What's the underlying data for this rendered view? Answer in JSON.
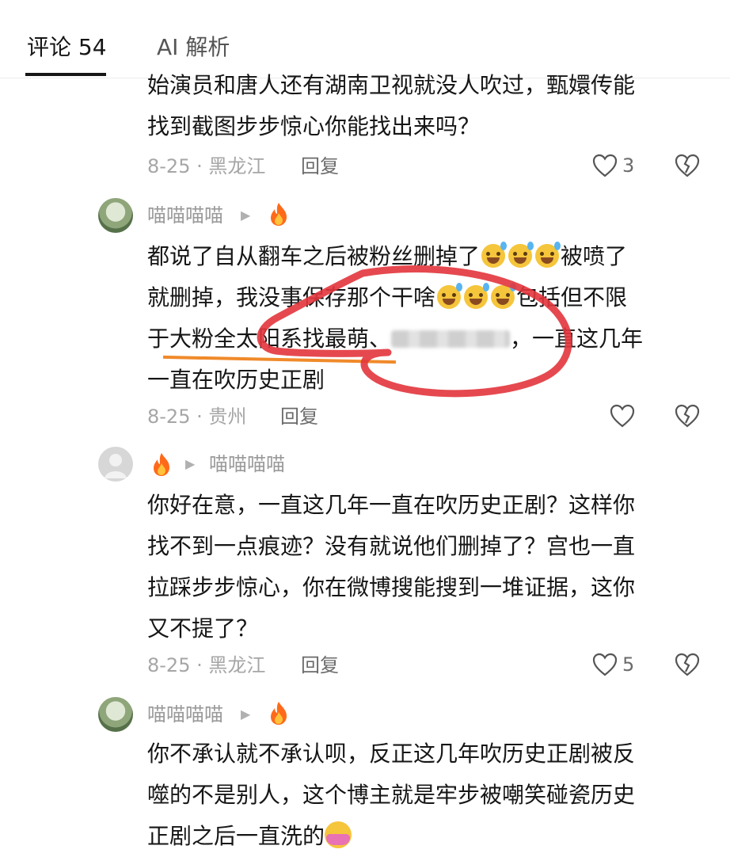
{
  "tabs": [
    {
      "label": "评论 54",
      "active": true
    },
    {
      "label": "AI 解析",
      "active": false
    }
  ],
  "comments": [
    {
      "lines": [
        "始演员和唐人还有湖南卫视就没人吹过，甄嬛传能",
        "找到截图步步惊心你能找出来吗？"
      ],
      "meta": "8-25 · 黑龙江",
      "reply": "回复",
      "likes": "3"
    },
    {
      "user": "喵喵喵喵",
      "lines_a": [
        "都说了自从翻车之后被粉丝删掉了",
        "被喷了"
      ],
      "line2_a": "就删掉，我没事保存那个干啥",
      "line2_b": "包括但不限",
      "line3_a": "于大粉全太阳系找最萌、",
      "line3_b": "，一直这几年",
      "line4": "一直在吹历史正剧",
      "meta": "8-25 · 贵州",
      "reply": "回复",
      "likes": ""
    },
    {
      "user": "喵喵喵喵",
      "lines": [
        "你好在意，一直这几年一直在吹历史正剧？这样你",
        "找不到一点痕迹？没有就说他们删掉了？宫也一直",
        "拉踩步步惊心，你在微博搜能搜到一堆证据，这你",
        "又不提了？"
      ],
      "meta": "8-25 · 黑龙江",
      "reply": "回复",
      "likes": "5"
    },
    {
      "user": "喵喵喵喵",
      "lines": [
        "你不承认就不承认呗，反正这几年吹历史正剧被反",
        "噬的不是别人，这个博主就是牢步被嘲笑碰瓷历史",
        "正剧之后一直洗的"
      ]
    }
  ],
  "colors": {
    "annotation_red": "#e2353c",
    "annotation_orange": "#f08a2a",
    "fire": "#ff6a1a"
  },
  "icons": [
    "heart-icon",
    "broken-heart-icon",
    "fire-icon",
    "play-arrow-icon"
  ]
}
